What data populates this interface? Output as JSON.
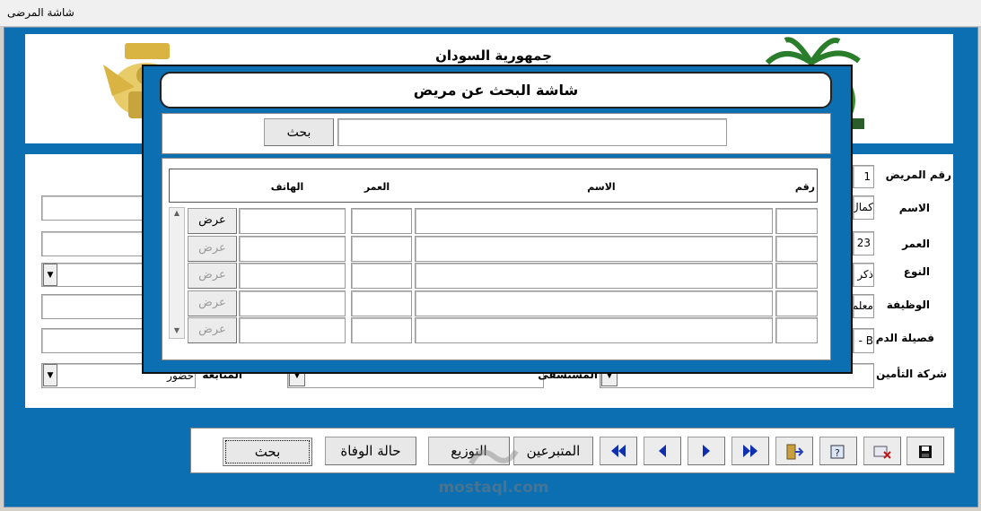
{
  "window": {
    "title": "شاشة المرضى"
  },
  "header": {
    "title": "جمهورية السودان"
  },
  "form": {
    "patient_no": {
      "label": "رقم المريض",
      "value": "1"
    },
    "name": {
      "label": "الاسم",
      "value": "كمال"
    },
    "age": {
      "label": "العمر",
      "value": "23"
    },
    "gender": {
      "label": "النوع",
      "value": "ذكر"
    },
    "job": {
      "label": "الوظيفة",
      "value": "معلم"
    },
    "blood_type": {
      "label": "فصيلة الدم",
      "value": "B -"
    },
    "insurance": {
      "label": "شركة التأمين"
    },
    "hospital": {
      "label": "المستشفى"
    },
    "followup": {
      "label": "المتابعة",
      "value": "حضور"
    }
  },
  "toolbar": {
    "search": "بحث",
    "death": "حالة الوفاة",
    "distribution": "التوزيع",
    "donors": "المتبرعين",
    "icons": [
      "first-record-icon",
      "prev-record-icon",
      "next-record-icon",
      "last-record-icon",
      "exit-icon",
      "query-icon",
      "cancel-icon",
      "save-icon"
    ]
  },
  "dialog": {
    "title": "شاشة البحث عن مريض",
    "search_button": "بحث",
    "search_value": "",
    "columns": {
      "no": "رقم",
      "name": "الاسم",
      "age": "العمر",
      "phone": "الهاتف"
    },
    "rows": [
      {
        "view": "عرض",
        "enabled": true
      },
      {
        "view": "عرض",
        "enabled": false
      },
      {
        "view": "عرض",
        "enabled": false
      },
      {
        "view": "عرض",
        "enabled": false
      },
      {
        "view": "عرض",
        "enabled": false
      }
    ]
  },
  "watermark": {
    "text": "mostaql.com"
  },
  "colors": {
    "app_background": "#0b6fb2",
    "panel": "#ffffff",
    "disabled_text": "#9a9a9a"
  }
}
